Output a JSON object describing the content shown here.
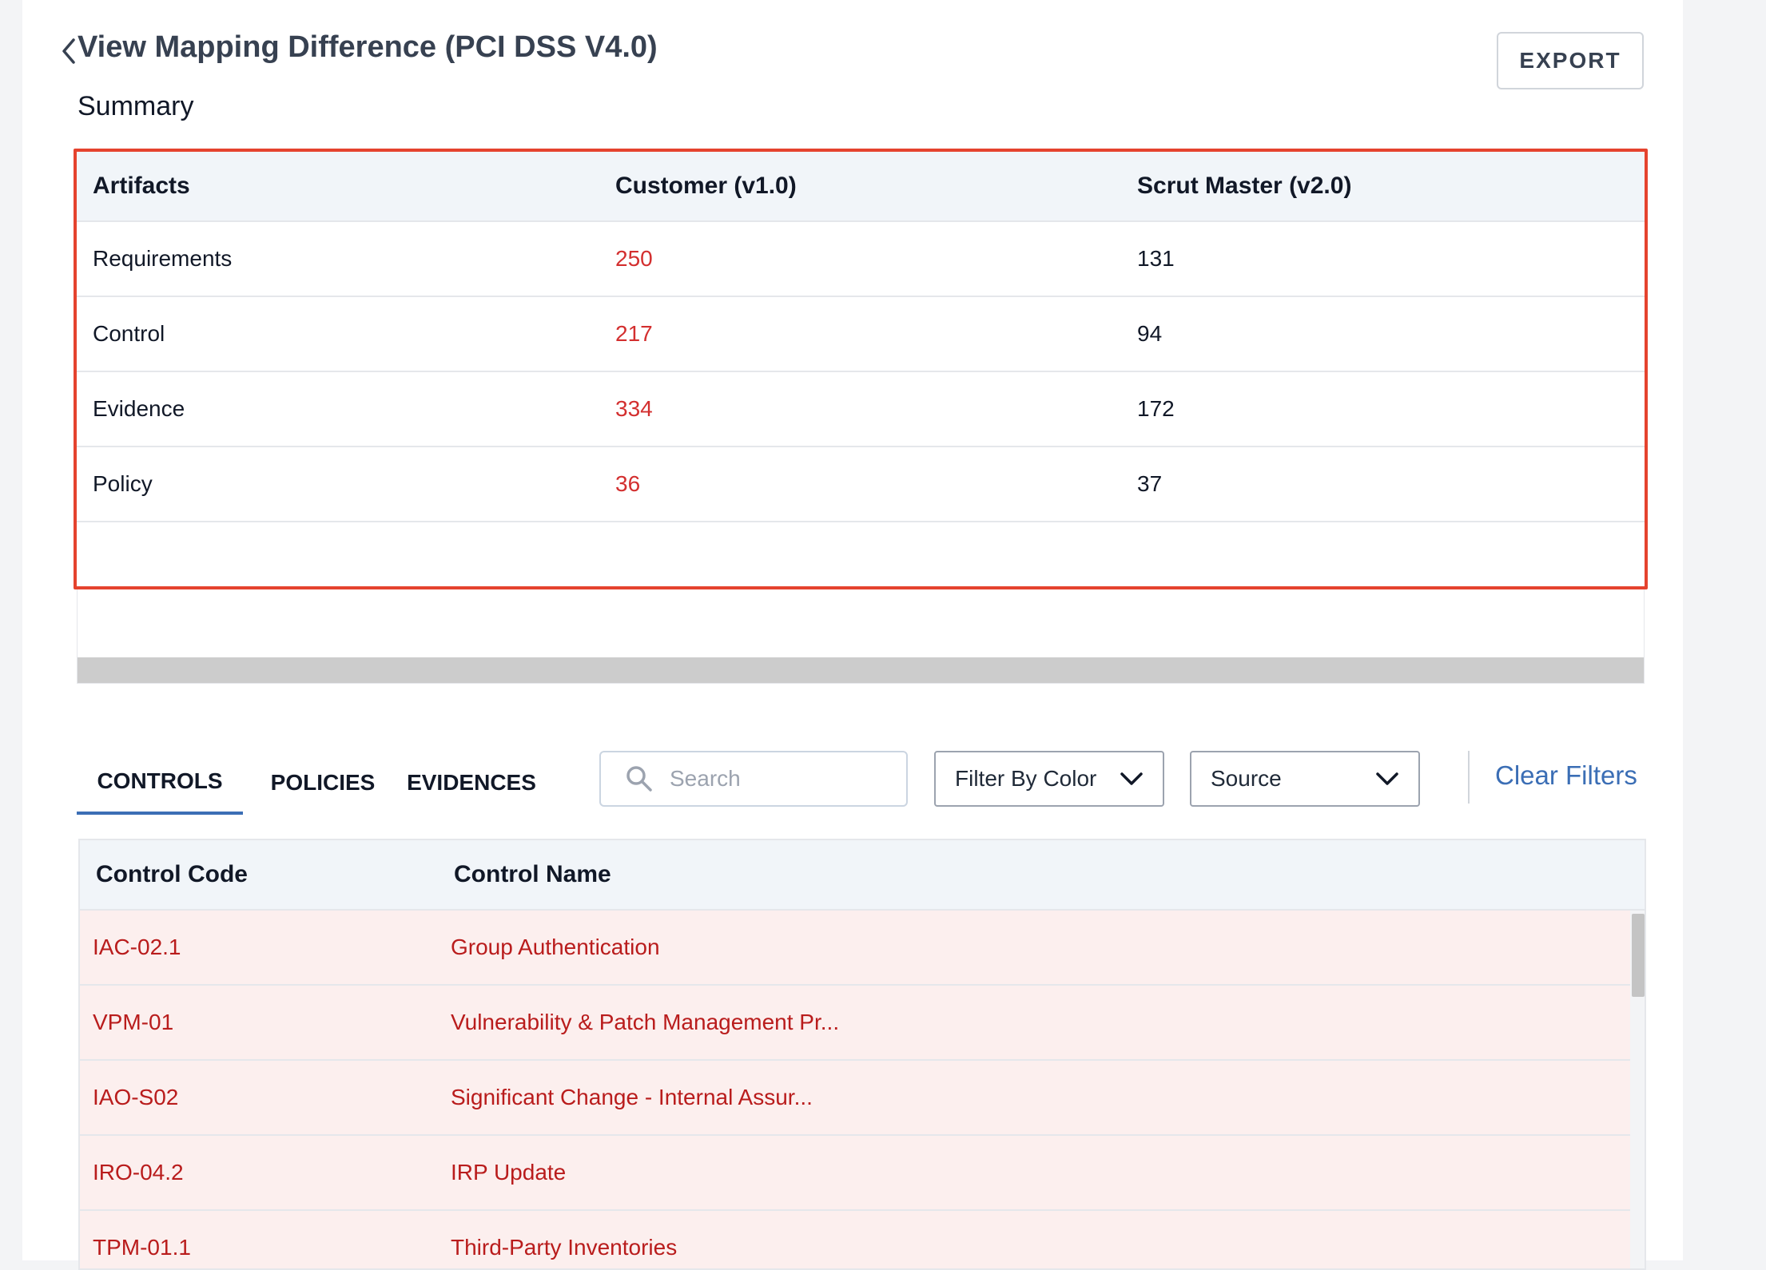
{
  "header": {
    "title": "View Mapping Difference (PCI DSS V4.0)",
    "export_label": "EXPORT",
    "back_icon": "chevron-left-icon"
  },
  "summary": {
    "title": "Summary",
    "columns": [
      "Artifacts",
      "Customer (v1.0)",
      "Scrut Master (v2.0)"
    ],
    "rows": [
      {
        "artifact": "Requirements",
        "customer": "250",
        "master": "131"
      },
      {
        "artifact": "Control",
        "customer": "217",
        "master": "94"
      },
      {
        "artifact": "Evidence",
        "customer": "334",
        "master": "172"
      },
      {
        "artifact": "Policy",
        "customer": "36",
        "master": "37"
      }
    ],
    "highlight_color": "#e5432e",
    "difference_color": "#d32f2f"
  },
  "tabs": [
    {
      "label": "CONTROLS",
      "active": true
    },
    {
      "label": "POLICIES",
      "active": false
    },
    {
      "label": "EVIDENCES",
      "active": false
    }
  ],
  "filters": {
    "search_placeholder": "Search",
    "color_filter": "Filter By Color",
    "source_filter": "Source",
    "clear_label": "Clear Filters",
    "accent_color": "#3b6eb5"
  },
  "controls_table": {
    "columns": [
      "Control Code",
      "Control Name"
    ],
    "rows": [
      {
        "code": "IAC-02.1",
        "name": "Group Authentication"
      },
      {
        "code": "VPM-01",
        "name": "Vulnerability & Patch Management Pr..."
      },
      {
        "code": "IAO-S02",
        "name": "Significant Change - Internal Assur..."
      },
      {
        "code": "IRO-04.2",
        "name": "IRP Update"
      },
      {
        "code": "TPM-01.1",
        "name": "Third-Party Inventories"
      }
    ],
    "row_background": "#fcefee",
    "row_text_color": "#b91c1c"
  }
}
